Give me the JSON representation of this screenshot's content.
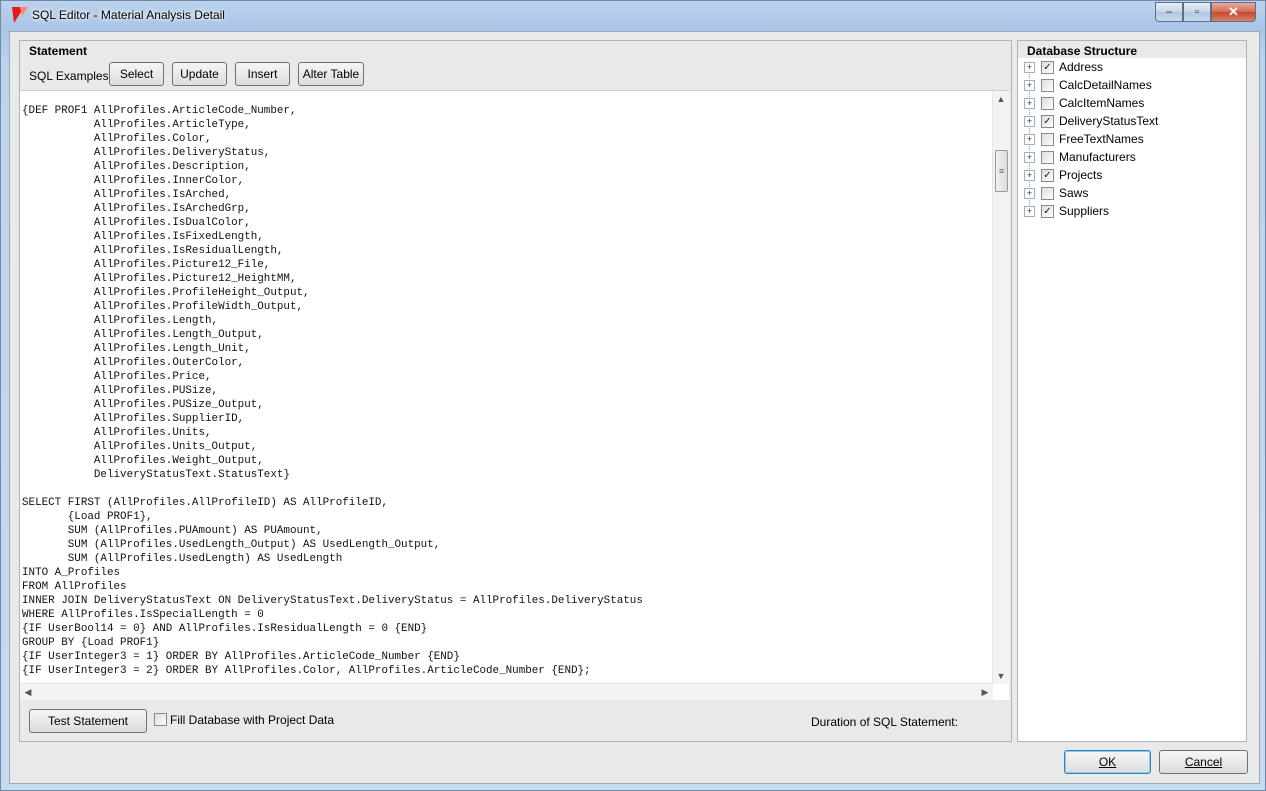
{
  "window": {
    "title": "SQL Editor - Material Analysis Detail",
    "buttons": {
      "minimize": "‒",
      "maximize": "▫",
      "close": "✕"
    }
  },
  "statement": {
    "title": "Statement",
    "examples_label": "SQL Examples:",
    "examples": [
      "Select",
      "Update",
      "Insert",
      "Alter Table"
    ],
    "code": "{DEF PROF1 AllProfiles.ArticleCode_Number,\n           AllProfiles.ArticleType,\n           AllProfiles.Color,\n           AllProfiles.DeliveryStatus,\n           AllProfiles.Description,\n           AllProfiles.InnerColor,\n           AllProfiles.IsArched,\n           AllProfiles.IsArchedGrp,\n           AllProfiles.IsDualColor,\n           AllProfiles.IsFixedLength,\n           AllProfiles.IsResidualLength,\n           AllProfiles.Picture12_File,\n           AllProfiles.Picture12_HeightMM,\n           AllProfiles.ProfileHeight_Output,\n           AllProfiles.ProfileWidth_Output,\n           AllProfiles.Length,\n           AllProfiles.Length_Output,\n           AllProfiles.Length_Unit,\n           AllProfiles.OuterColor,\n           AllProfiles.Price,\n           AllProfiles.PUSize,\n           AllProfiles.PUSize_Output,\n           AllProfiles.SupplierID,\n           AllProfiles.Units,\n           AllProfiles.Units_Output,\n           AllProfiles.Weight_Output,\n           DeliveryStatusText.StatusText}\n\nSELECT FIRST (AllProfiles.AllProfileID) AS AllProfileID,\n       {Load PROF1},\n       SUM (AllProfiles.PUAmount) AS PUAmount,\n       SUM (AllProfiles.UsedLength_Output) AS UsedLength_Output,\n       SUM (AllProfiles.UsedLength) AS UsedLength\nINTO A_Profiles\nFROM AllProfiles\nINNER JOIN DeliveryStatusText ON DeliveryStatusText.DeliveryStatus = AllProfiles.DeliveryStatus\nWHERE AllProfiles.IsSpecialLength = 0\n{IF UserBool14 = 0} AND AllProfiles.IsResidualLength = 0 {END}\nGROUP BY {Load PROF1}\n{IF UserInteger3 = 1} ORDER BY AllProfiles.ArticleCode_Number {END}\n{IF UserInteger3 = 2} ORDER BY AllProfiles.Color, AllProfiles.ArticleCode_Number {END};",
    "test_button": "Test Statement",
    "fill_checkbox_label": "Fill Database with Project Data",
    "fill_checked": false,
    "duration_label": "Duration of SQL Statement:"
  },
  "database": {
    "title": "Database Structure",
    "items": [
      {
        "label": "Address",
        "checked": true
      },
      {
        "label": "CalcDetailNames",
        "checked": false
      },
      {
        "label": "CalcItemNames",
        "checked": false
      },
      {
        "label": "DeliveryStatusText",
        "checked": true
      },
      {
        "label": "FreeTextNames",
        "checked": false
      },
      {
        "label": "Manufacturers",
        "checked": false
      },
      {
        "label": "Projects",
        "checked": true
      },
      {
        "label": "Saws",
        "checked": false
      },
      {
        "label": "Suppliers",
        "checked": true
      }
    ]
  },
  "dialog": {
    "ok_label": "OK",
    "cancel_label": "Cancel"
  }
}
